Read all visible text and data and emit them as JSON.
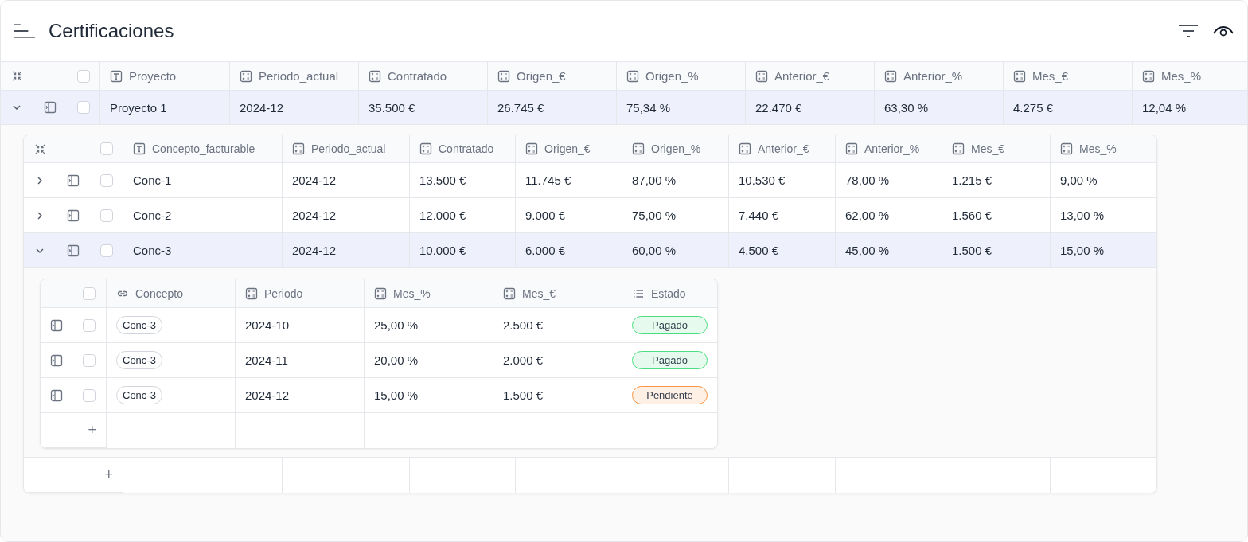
{
  "header": {
    "title": "Certificaciones"
  },
  "table": {
    "checked": false,
    "columns": [
      {
        "label": "Proyecto",
        "kind": "text"
      },
      {
        "label": "Periodo_actual",
        "kind": "number"
      },
      {
        "label": "Contratado",
        "kind": "number"
      },
      {
        "label": "Origen_€",
        "kind": "number"
      },
      {
        "label": "Origen_%",
        "kind": "number"
      },
      {
        "label": "Anterior_€",
        "kind": "number"
      },
      {
        "label": "Anterior_%",
        "kind": "number"
      },
      {
        "label": "Mes_€",
        "kind": "number"
      },
      {
        "label": "Mes_%",
        "kind": "number"
      }
    ],
    "rows": [
      {
        "expanded": true,
        "checked": false,
        "cells": [
          "Proyecto 1",
          "2024-12",
          "35.500 €",
          "26.745 €",
          "75,34 %",
          "22.470 €",
          "63,30 %",
          "4.275 €",
          "12,04 %"
        ],
        "subtable": {
          "checked": false,
          "add_button": "+",
          "columns": [
            {
              "label": "Concepto_facturable",
              "kind": "text"
            },
            {
              "label": "Periodo_actual",
              "kind": "number"
            },
            {
              "label": "Contratado",
              "kind": "number"
            },
            {
              "label": "Origen_€",
              "kind": "number"
            },
            {
              "label": "Origen_%",
              "kind": "number"
            },
            {
              "label": "Anterior_€",
              "kind": "number"
            },
            {
              "label": "Anterior_%",
              "kind": "number"
            },
            {
              "label": "Mes_€",
              "kind": "number"
            },
            {
              "label": "Mes_%",
              "kind": "number"
            }
          ],
          "rows": [
            {
              "expanded": false,
              "checked": false,
              "cells": [
                "Conc-1",
                "2024-12",
                "13.500 €",
                "11.745 €",
                "87,00 %",
                "10.530 €",
                "78,00 %",
                "1.215 €",
                "9,00 %"
              ]
            },
            {
              "expanded": false,
              "checked": false,
              "cells": [
                "Conc-2",
                "2024-12",
                "12.000 €",
                "9.000 €",
                "75,00 %",
                "7.440 €",
                "62,00 %",
                "1.560 €",
                "13,00 %"
              ]
            },
            {
              "expanded": true,
              "checked": false,
              "cells": [
                "Conc-3",
                "2024-12",
                "10.000 €",
                "6.000 €",
                "60,00 %",
                "4.500 €",
                "45,00 %",
                "1.500 €",
                "15,00 %"
              ],
              "subtable": {
                "checked": false,
                "add_button": "+",
                "columns": [
                  {
                    "label": "Concepto",
                    "kind": "link"
                  },
                  {
                    "label": "Periodo",
                    "kind": "number"
                  },
                  {
                    "label": "Mes_%",
                    "kind": "number"
                  },
                  {
                    "label": "Mes_€",
                    "kind": "number"
                  },
                  {
                    "label": "Estado",
                    "kind": "list"
                  }
                ],
                "rows": [
                  {
                    "checked": false,
                    "cells": [
                      "Conc-3",
                      "2024-10",
                      "25,00 %",
                      "2.500 €",
                      {
                        "label": "Pagado",
                        "color": "#4ade80"
                      }
                    ]
                  },
                  {
                    "checked": false,
                    "cells": [
                      "Conc-3",
                      "2024-11",
                      "20,00 %",
                      "2.000 €",
                      {
                        "label": "Pagado",
                        "color": "#4ade80"
                      }
                    ]
                  },
                  {
                    "checked": false,
                    "cells": [
                      "Conc-3",
                      "2024-12",
                      "15,00 %",
                      "1.500 €",
                      {
                        "label": "Pendiente",
                        "color": "#fb923c"
                      }
                    ]
                  }
                ]
              }
            }
          ]
        }
      }
    ]
  }
}
